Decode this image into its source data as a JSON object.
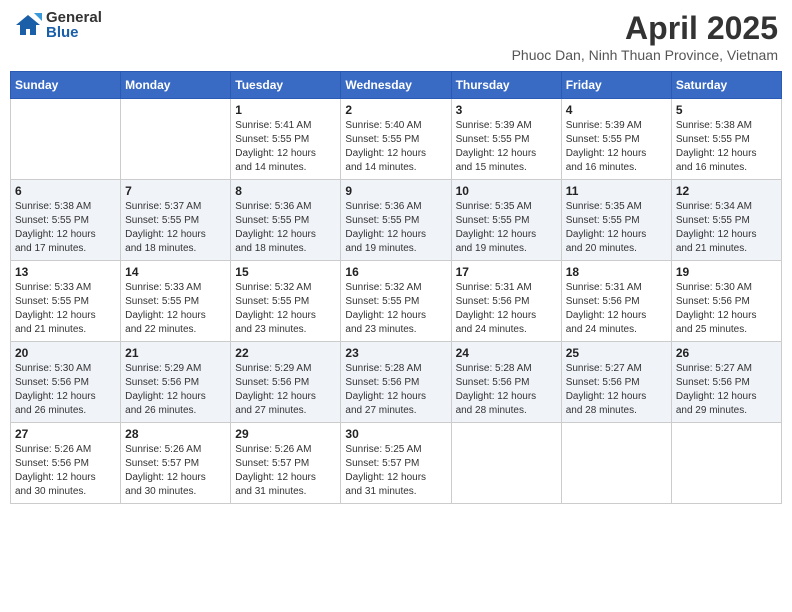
{
  "header": {
    "logo_general": "General",
    "logo_blue": "Blue",
    "month_title": "April 2025",
    "location": "Phuoc Dan, Ninh Thuan Province, Vietnam"
  },
  "days_of_week": [
    "Sunday",
    "Monday",
    "Tuesday",
    "Wednesday",
    "Thursday",
    "Friday",
    "Saturday"
  ],
  "weeks": [
    [
      {
        "day": "",
        "info": ""
      },
      {
        "day": "",
        "info": ""
      },
      {
        "day": "1",
        "info": "Sunrise: 5:41 AM\nSunset: 5:55 PM\nDaylight: 12 hours\nand 14 minutes."
      },
      {
        "day": "2",
        "info": "Sunrise: 5:40 AM\nSunset: 5:55 PM\nDaylight: 12 hours\nand 14 minutes."
      },
      {
        "day": "3",
        "info": "Sunrise: 5:39 AM\nSunset: 5:55 PM\nDaylight: 12 hours\nand 15 minutes."
      },
      {
        "day": "4",
        "info": "Sunrise: 5:39 AM\nSunset: 5:55 PM\nDaylight: 12 hours\nand 16 minutes."
      },
      {
        "day": "5",
        "info": "Sunrise: 5:38 AM\nSunset: 5:55 PM\nDaylight: 12 hours\nand 16 minutes."
      }
    ],
    [
      {
        "day": "6",
        "info": "Sunrise: 5:38 AM\nSunset: 5:55 PM\nDaylight: 12 hours\nand 17 minutes."
      },
      {
        "day": "7",
        "info": "Sunrise: 5:37 AM\nSunset: 5:55 PM\nDaylight: 12 hours\nand 18 minutes."
      },
      {
        "day": "8",
        "info": "Sunrise: 5:36 AM\nSunset: 5:55 PM\nDaylight: 12 hours\nand 18 minutes."
      },
      {
        "day": "9",
        "info": "Sunrise: 5:36 AM\nSunset: 5:55 PM\nDaylight: 12 hours\nand 19 minutes."
      },
      {
        "day": "10",
        "info": "Sunrise: 5:35 AM\nSunset: 5:55 PM\nDaylight: 12 hours\nand 19 minutes."
      },
      {
        "day": "11",
        "info": "Sunrise: 5:35 AM\nSunset: 5:55 PM\nDaylight: 12 hours\nand 20 minutes."
      },
      {
        "day": "12",
        "info": "Sunrise: 5:34 AM\nSunset: 5:55 PM\nDaylight: 12 hours\nand 21 minutes."
      }
    ],
    [
      {
        "day": "13",
        "info": "Sunrise: 5:33 AM\nSunset: 5:55 PM\nDaylight: 12 hours\nand 21 minutes."
      },
      {
        "day": "14",
        "info": "Sunrise: 5:33 AM\nSunset: 5:55 PM\nDaylight: 12 hours\nand 22 minutes."
      },
      {
        "day": "15",
        "info": "Sunrise: 5:32 AM\nSunset: 5:55 PM\nDaylight: 12 hours\nand 23 minutes."
      },
      {
        "day": "16",
        "info": "Sunrise: 5:32 AM\nSunset: 5:55 PM\nDaylight: 12 hours\nand 23 minutes."
      },
      {
        "day": "17",
        "info": "Sunrise: 5:31 AM\nSunset: 5:56 PM\nDaylight: 12 hours\nand 24 minutes."
      },
      {
        "day": "18",
        "info": "Sunrise: 5:31 AM\nSunset: 5:56 PM\nDaylight: 12 hours\nand 24 minutes."
      },
      {
        "day": "19",
        "info": "Sunrise: 5:30 AM\nSunset: 5:56 PM\nDaylight: 12 hours\nand 25 minutes."
      }
    ],
    [
      {
        "day": "20",
        "info": "Sunrise: 5:30 AM\nSunset: 5:56 PM\nDaylight: 12 hours\nand 26 minutes."
      },
      {
        "day": "21",
        "info": "Sunrise: 5:29 AM\nSunset: 5:56 PM\nDaylight: 12 hours\nand 26 minutes."
      },
      {
        "day": "22",
        "info": "Sunrise: 5:29 AM\nSunset: 5:56 PM\nDaylight: 12 hours\nand 27 minutes."
      },
      {
        "day": "23",
        "info": "Sunrise: 5:28 AM\nSunset: 5:56 PM\nDaylight: 12 hours\nand 27 minutes."
      },
      {
        "day": "24",
        "info": "Sunrise: 5:28 AM\nSunset: 5:56 PM\nDaylight: 12 hours\nand 28 minutes."
      },
      {
        "day": "25",
        "info": "Sunrise: 5:27 AM\nSunset: 5:56 PM\nDaylight: 12 hours\nand 28 minutes."
      },
      {
        "day": "26",
        "info": "Sunrise: 5:27 AM\nSunset: 5:56 PM\nDaylight: 12 hours\nand 29 minutes."
      }
    ],
    [
      {
        "day": "27",
        "info": "Sunrise: 5:26 AM\nSunset: 5:56 PM\nDaylight: 12 hours\nand 30 minutes."
      },
      {
        "day": "28",
        "info": "Sunrise: 5:26 AM\nSunset: 5:57 PM\nDaylight: 12 hours\nand 30 minutes."
      },
      {
        "day": "29",
        "info": "Sunrise: 5:26 AM\nSunset: 5:57 PM\nDaylight: 12 hours\nand 31 minutes."
      },
      {
        "day": "30",
        "info": "Sunrise: 5:25 AM\nSunset: 5:57 PM\nDaylight: 12 hours\nand 31 minutes."
      },
      {
        "day": "",
        "info": ""
      },
      {
        "day": "",
        "info": ""
      },
      {
        "day": "",
        "info": ""
      }
    ]
  ]
}
